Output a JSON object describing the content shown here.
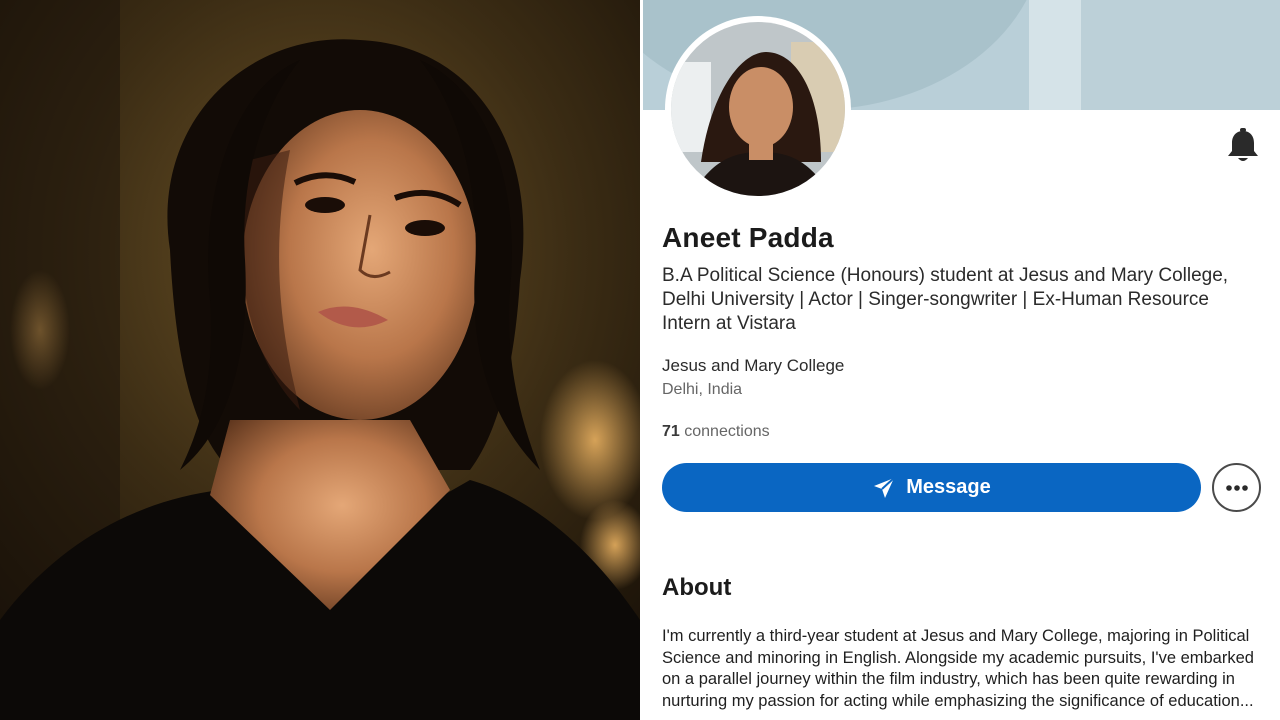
{
  "profile": {
    "name": "Aneet Padda",
    "headline": "B.A Political Science (Honours) student at Jesus and Mary College, Delhi University | Actor | Singer-songwriter | Ex-Human Resource Intern at Vistara",
    "school": "Jesus and Mary College",
    "location": "Delhi, India",
    "connections_count": "71",
    "connections_label": "connections"
  },
  "actions": {
    "message_label": "Message",
    "message_icon": "send-icon",
    "more_icon": "more-horizontal-icon",
    "notify_icon": "bell-icon"
  },
  "about": {
    "title": "About",
    "text": "I'm currently a third-year student at Jesus and Mary College, majoring in Political Science and minoring in English. Alongside my academic pursuits, I've embarked on a parallel journey within the film industry, which has been quite rewarding in nurturing my passion for acting while emphasizing the significance of education..."
  },
  "colors": {
    "primary_button": "#0a66c2",
    "banner": "#b9cfd8"
  }
}
